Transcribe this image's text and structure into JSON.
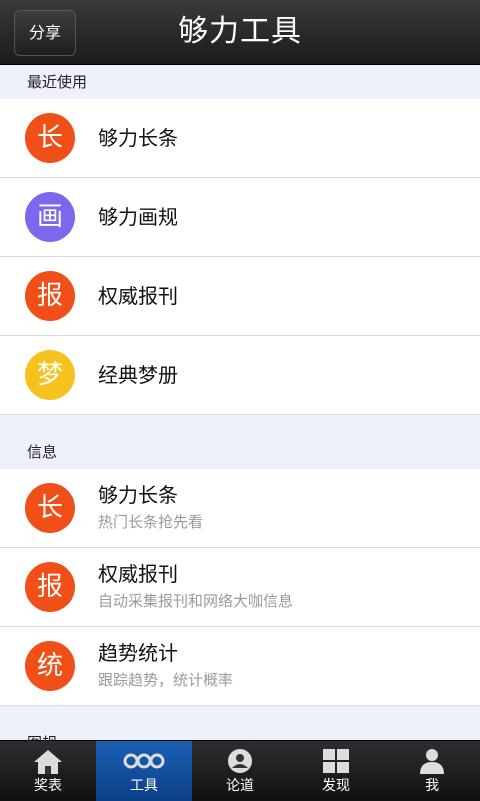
{
  "header": {
    "share_label": "分享",
    "title": "够力工具"
  },
  "sections": [
    {
      "title": "最近使用",
      "items": [
        {
          "icon_char": "长",
          "color": "#f04f17",
          "label": "够力长条"
        },
        {
          "icon_char": "画",
          "color": "#7b68ee",
          "label": "够力画规"
        },
        {
          "icon_char": "报",
          "color": "#f04f17",
          "label": "权威报刊"
        },
        {
          "icon_char": "梦",
          "color": "#f6c21f",
          "label": "经典梦册"
        }
      ]
    },
    {
      "title": "信息",
      "items": [
        {
          "icon_char": "长",
          "color": "#f04f17",
          "label": "够力长条",
          "subtitle": "热门长条抢先看"
        },
        {
          "icon_char": "报",
          "color": "#f04f17",
          "label": "权威报刊",
          "subtitle": "自动采集报刊和网络大咖信息"
        },
        {
          "icon_char": "统",
          "color": "#f04f17",
          "label": "趋势统计",
          "subtitle": "跟踪趋势，统计概率"
        }
      ]
    },
    {
      "title": "图规"
    }
  ],
  "tabs": [
    {
      "label": "奖表",
      "icon": "house-icon"
    },
    {
      "label": "工具",
      "icon": "dots-icon",
      "active": true
    },
    {
      "label": "论道",
      "icon": "person-circle-icon"
    },
    {
      "label": "发现",
      "icon": "grid-icon"
    },
    {
      "label": "我",
      "icon": "person-icon"
    }
  ]
}
